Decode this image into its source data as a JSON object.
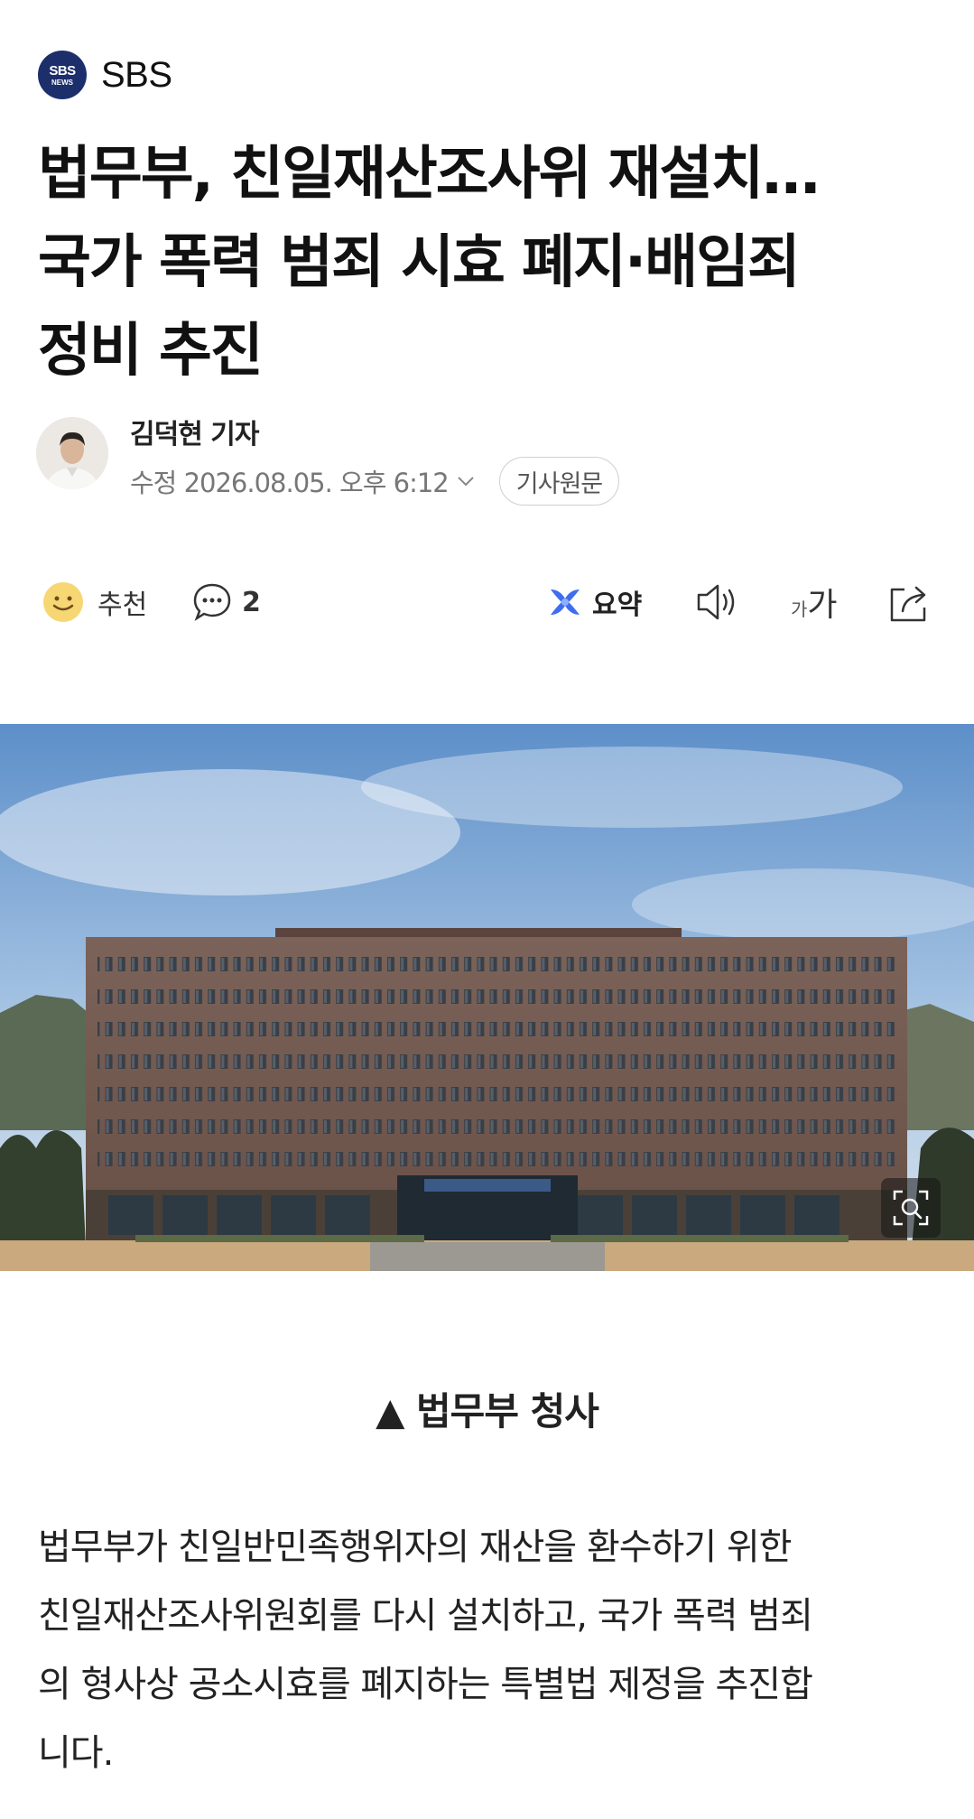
{
  "press": {
    "logo_line1": "SBS",
    "logo_line2": "NEWS",
    "name": "SBS"
  },
  "headline": {
    "lines": [
      "법무부, 친일재산조사위 재설치…",
      "국가 폭력 범죄 시효 폐지·배임죄",
      "정비 추진"
    ]
  },
  "byline": {
    "reporter": "김덕현 기자",
    "modified": "수정 2026.08.05. 오후 6:12",
    "original_button": "기사원문"
  },
  "toolbar": {
    "recommend_label": "추천",
    "comment_count": "2",
    "summary_label": "요약",
    "font_small": "가",
    "font_large": "가",
    "icons": [
      "smile-emoji-icon",
      "comment-icon",
      "ai-summary-icon",
      "speaker-icon",
      "font-size-icon",
      "share-icon"
    ]
  },
  "photo": {
    "caption": "▲ 법무부 청사"
  },
  "article": {
    "lines": [
      "법무부가 친일반민족행위자의 재산을 환수하기 위한",
      "친일재산조사위원회를 다시 설치하고, 국가 폭력 범죄",
      "의 형사상 공소시효를 폐지하는 특별법 제정을 추진합",
      "니다."
    ]
  },
  "colors": {
    "press_logo": "#1c2f6b",
    "summary_accent": "#3f6df0",
    "text": "#111111"
  }
}
